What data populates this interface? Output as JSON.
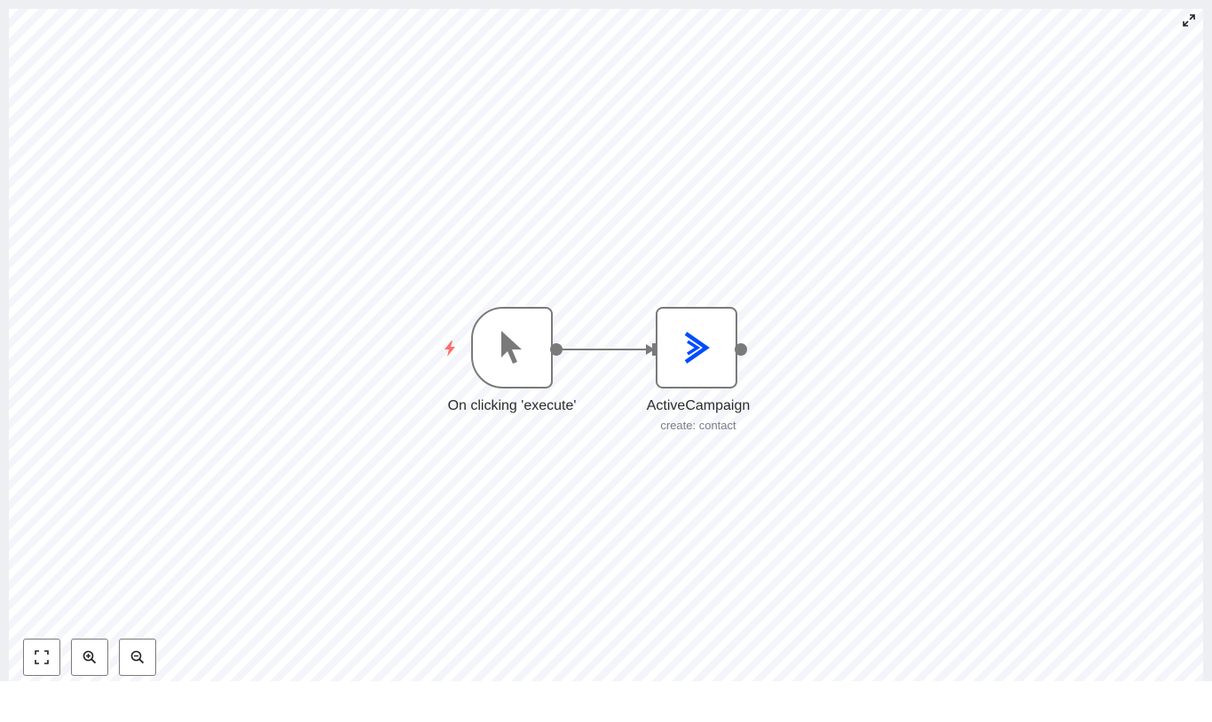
{
  "canvas": {
    "nodes": [
      {
        "id": "trigger",
        "label": "On clicking 'execute'",
        "subtitle": "",
        "icon": "mouse-pointer-icon",
        "type": "trigger"
      },
      {
        "id": "activecampaign",
        "label": "ActiveCampaign",
        "subtitle": "create: contact",
        "icon": "activecampaign-logo-icon",
        "icon_color": "#004cff"
      }
    ],
    "connections": [
      {
        "from": "trigger",
        "to": "activecampaign"
      }
    ],
    "trigger_badge": {
      "icon": "lightning-bolt-icon",
      "color": "#ff6d6d"
    }
  },
  "controls": {
    "buttons": [
      {
        "name": "zoom-to-fit",
        "icon": "fit-screen-icon"
      },
      {
        "name": "zoom-in",
        "icon": "zoom-in-icon"
      },
      {
        "name": "zoom-out",
        "icon": "zoom-out-icon"
      }
    ],
    "fullscreen_icon": "expand-arrows-icon"
  },
  "colors": {
    "node_border": "#7a7a7a",
    "canvas_bg": "#f5f6fa",
    "brand_blue": "#004cff",
    "trigger_red": "#ff6d6d"
  }
}
